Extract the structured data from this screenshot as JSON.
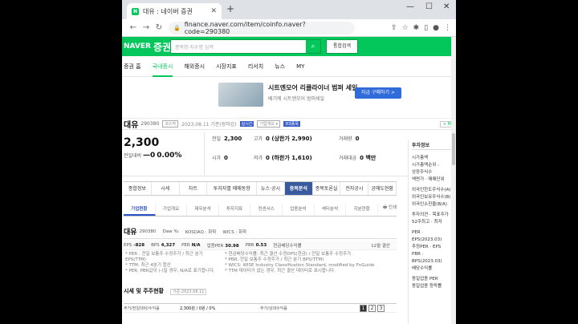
{
  "browser": {
    "tab_title": "대유 : 네이버 증권",
    "url": "finance.naver.com/item/coinfo.naver?code=290380"
  },
  "naver": {
    "logo": "NAVER",
    "logo_sub": "증권",
    "search_placeholder": "종목명·지수명 입력",
    "total_search": "통합검색"
  },
  "menu": [
    "증권 홈",
    "국내증시",
    "해외증시",
    "시장지표",
    "리서치",
    "뉴스",
    "MY"
  ],
  "ad": {
    "title": "시트엔모어 리클라이너 범퍼 세일",
    "subtitle": "베기에 시트엔모어 범퍼세일",
    "button": "자금 구매하기 >"
  },
  "stock": {
    "name": "대유",
    "code": "290380",
    "market": "코스닥",
    "date": "2023.08.11 기준(장마감)",
    "tag1": "실시간",
    "tag2": "기업개요 ▾",
    "tag3": "3대종목",
    "price": "2,300",
    "change_label": "전일대비",
    "change": "—0",
    "change_pct": "0.00%",
    "prev_label": "전일",
    "prev": "2,300",
    "high_label": "고가",
    "high": "0 (상한가 2,990)",
    "volume_label": "거래량",
    "volume": "0",
    "open_label": "시가",
    "open": "0",
    "low_label": "저가",
    "low": "0 (하한가 1,610)",
    "amount_label": "거래대금",
    "amount": "0 백만"
  },
  "side": {
    "title": "투자정보",
    "lines": [
      "시가총액",
      "시가총액순위 :",
      "상장주식수",
      "액면가 · 매매단위",
      "외국인한도주식수(A)",
      "외국인보유주식수(B)",
      "외국인소진율(B/A)",
      "투자의견 · 목표주가",
      "52주최고 · 최저",
      "PER · EPS(2023.03)",
      "추정PER · EPS",
      "PBR · BPS(2023.03)",
      "배당수익률",
      "동일업종 PER",
      "동일업종 등락률"
    ]
  },
  "main_tabs": [
    "종합정보",
    "시세",
    "차트",
    "투자자별 매매동향",
    "뉴스·공시",
    "종목분석",
    "종목토론실",
    "전자공시",
    "공매도현황"
  ],
  "sub_tabs": [
    "기업현황",
    "기업개요",
    "재무분석",
    "투자지표",
    "컨센서스",
    "업종분석",
    "섹터분석",
    "지분현황"
  ],
  "print_label": "인쇄",
  "company": {
    "name": "대유",
    "code": "290380",
    "eng": "Daw Yu",
    "market": "KOSDAQ : 화학",
    "wics": "WICS : 화학",
    "eps": "-828",
    "bps": "4,327",
    "per": "N/A",
    "industry_per": "30.98",
    "pbr": "0.53",
    "div_label": "현금배당수익률",
    "settle": "12월 결산",
    "note_left": [
      "* PER : 전일 보통주 수정주가 / 최근 분기 EPS(TTM)",
      "* TTM: 최근 4분기 합산",
      "* PER, PBR값이 (-)일 경우, N/A로 표기합니다."
    ],
    "note_right": [
      "* 현금배당수익률: 최근 결산 수정DPS(현금) / 전일 보통주 수정주가",
      "* PBR: 전일 보통주 수정주가 / 최근 분기 BPS(TTM)",
      "* WICS: WISE Industry Classification Standard, modified by FnGuide",
      "* TTM 데이터가 없는 경우, 최근 결산 데이터로 표시합니다."
    ],
    "section": "시세 및 주주현황",
    "section_date": "기준:2023.08.11",
    "row_label": "주가/전일대비/수익률",
    "row_value": "2,300원 / 0원 / 0%",
    "row_label2": "주가/상대수익률"
  },
  "pages": [
    "1",
    "2",
    "3"
  ]
}
